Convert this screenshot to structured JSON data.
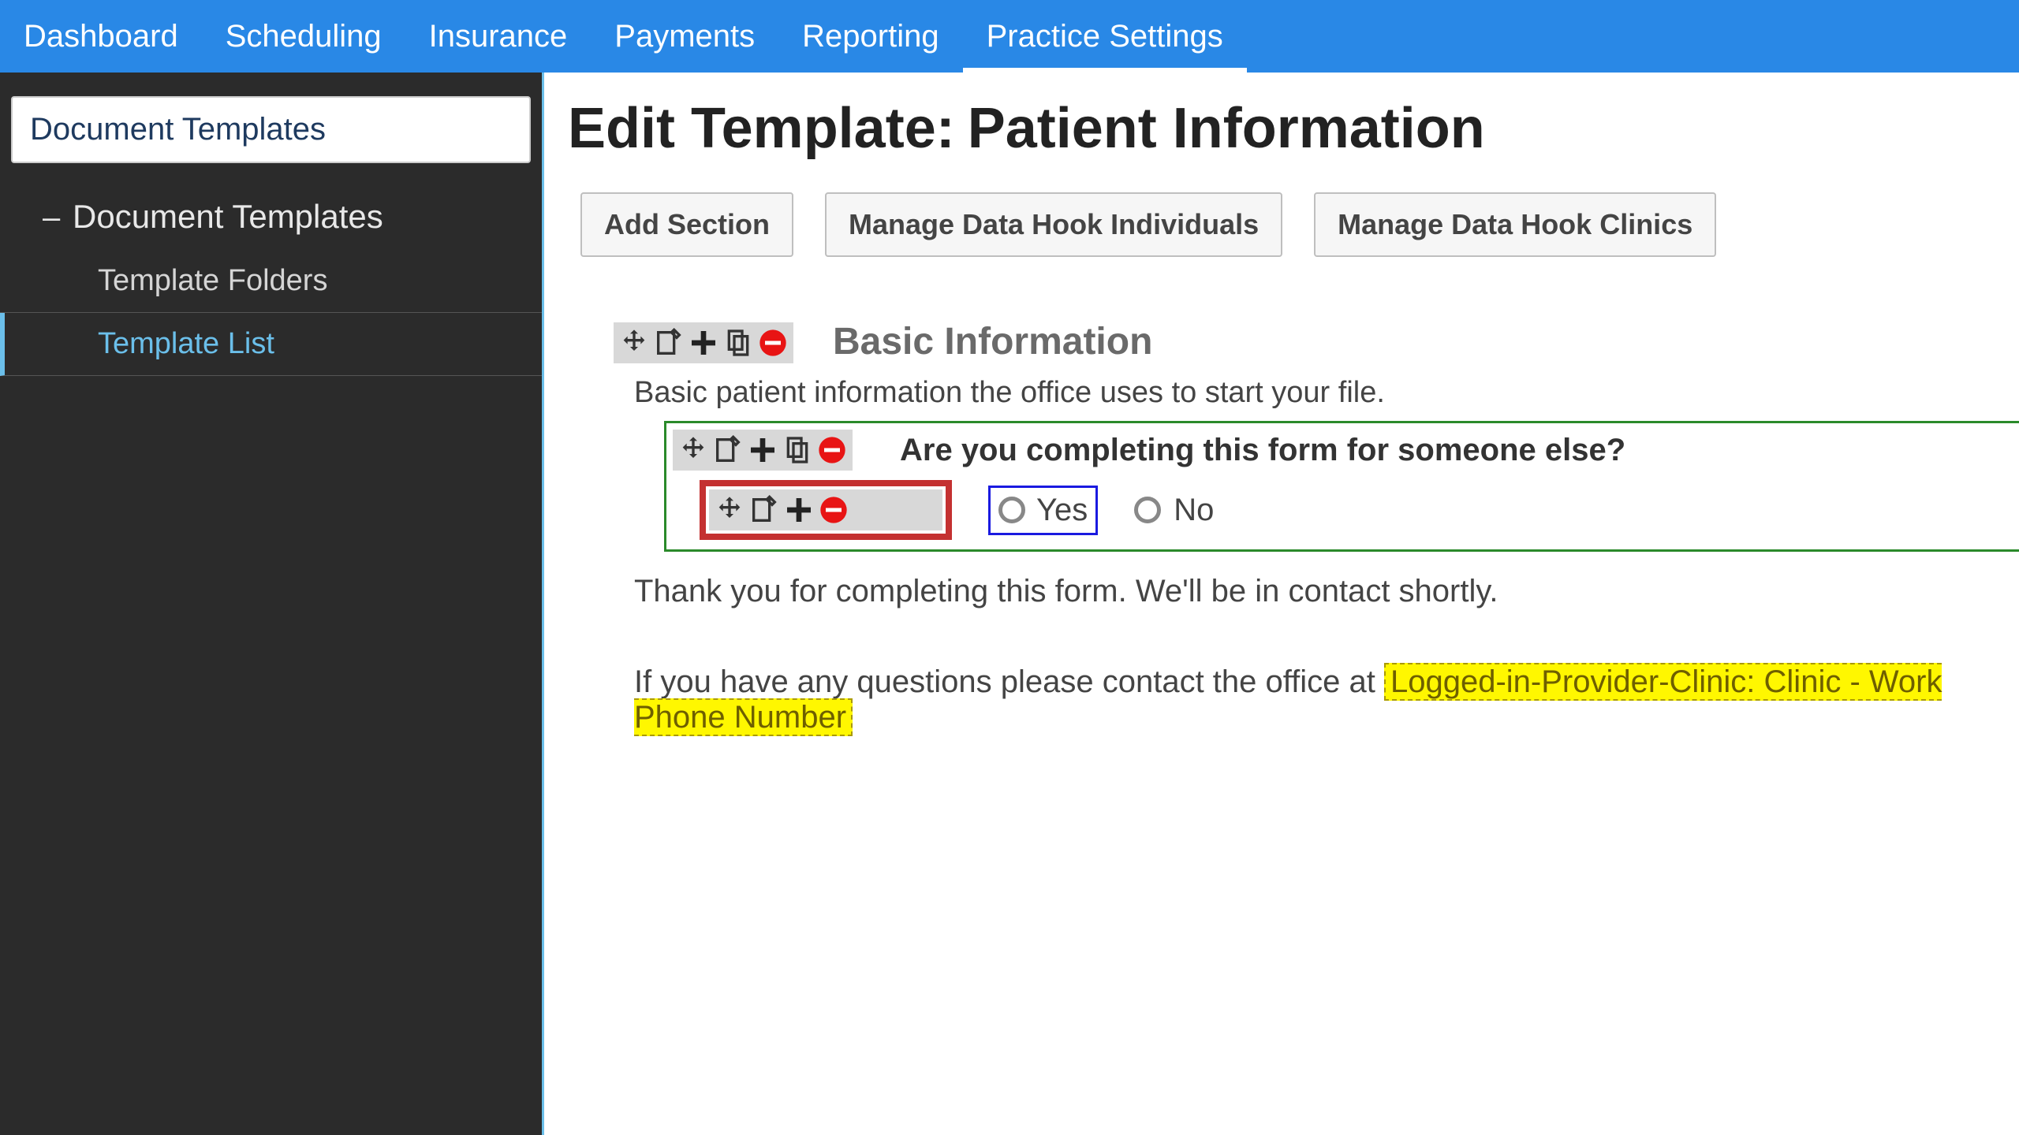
{
  "topnav": {
    "items": [
      {
        "label": "Dashboard"
      },
      {
        "label": "Scheduling"
      },
      {
        "label": "Insurance"
      },
      {
        "label": "Payments"
      },
      {
        "label": "Reporting"
      },
      {
        "label": "Practice Settings"
      }
    ]
  },
  "sidebar": {
    "header": "Document Templates",
    "group_label": "Document Templates",
    "items": [
      {
        "label": "Template Folders"
      },
      {
        "label": "Template List"
      }
    ]
  },
  "page": {
    "title_prefix": "Edit Template:",
    "title_name": "Patient Information"
  },
  "buttons": {
    "add_section": "Add Section",
    "manage_individuals": "Manage Data Hook Individuals",
    "manage_clinics": "Manage Data Hook Clinics"
  },
  "section": {
    "title": "Basic Information",
    "description": "Basic patient information the office uses to start your file.",
    "question": "Are you completing this form for someone else?",
    "option_yes": "Yes",
    "option_no": "No"
  },
  "footer": {
    "thanks": "Thank you for completing this form. We'll be in contact shortly.",
    "contact_prefix": "If you have any questions please contact the office at ",
    "data_hook": "Logged-in-Provider-Clinic: Clinic - Work Phone Number"
  }
}
